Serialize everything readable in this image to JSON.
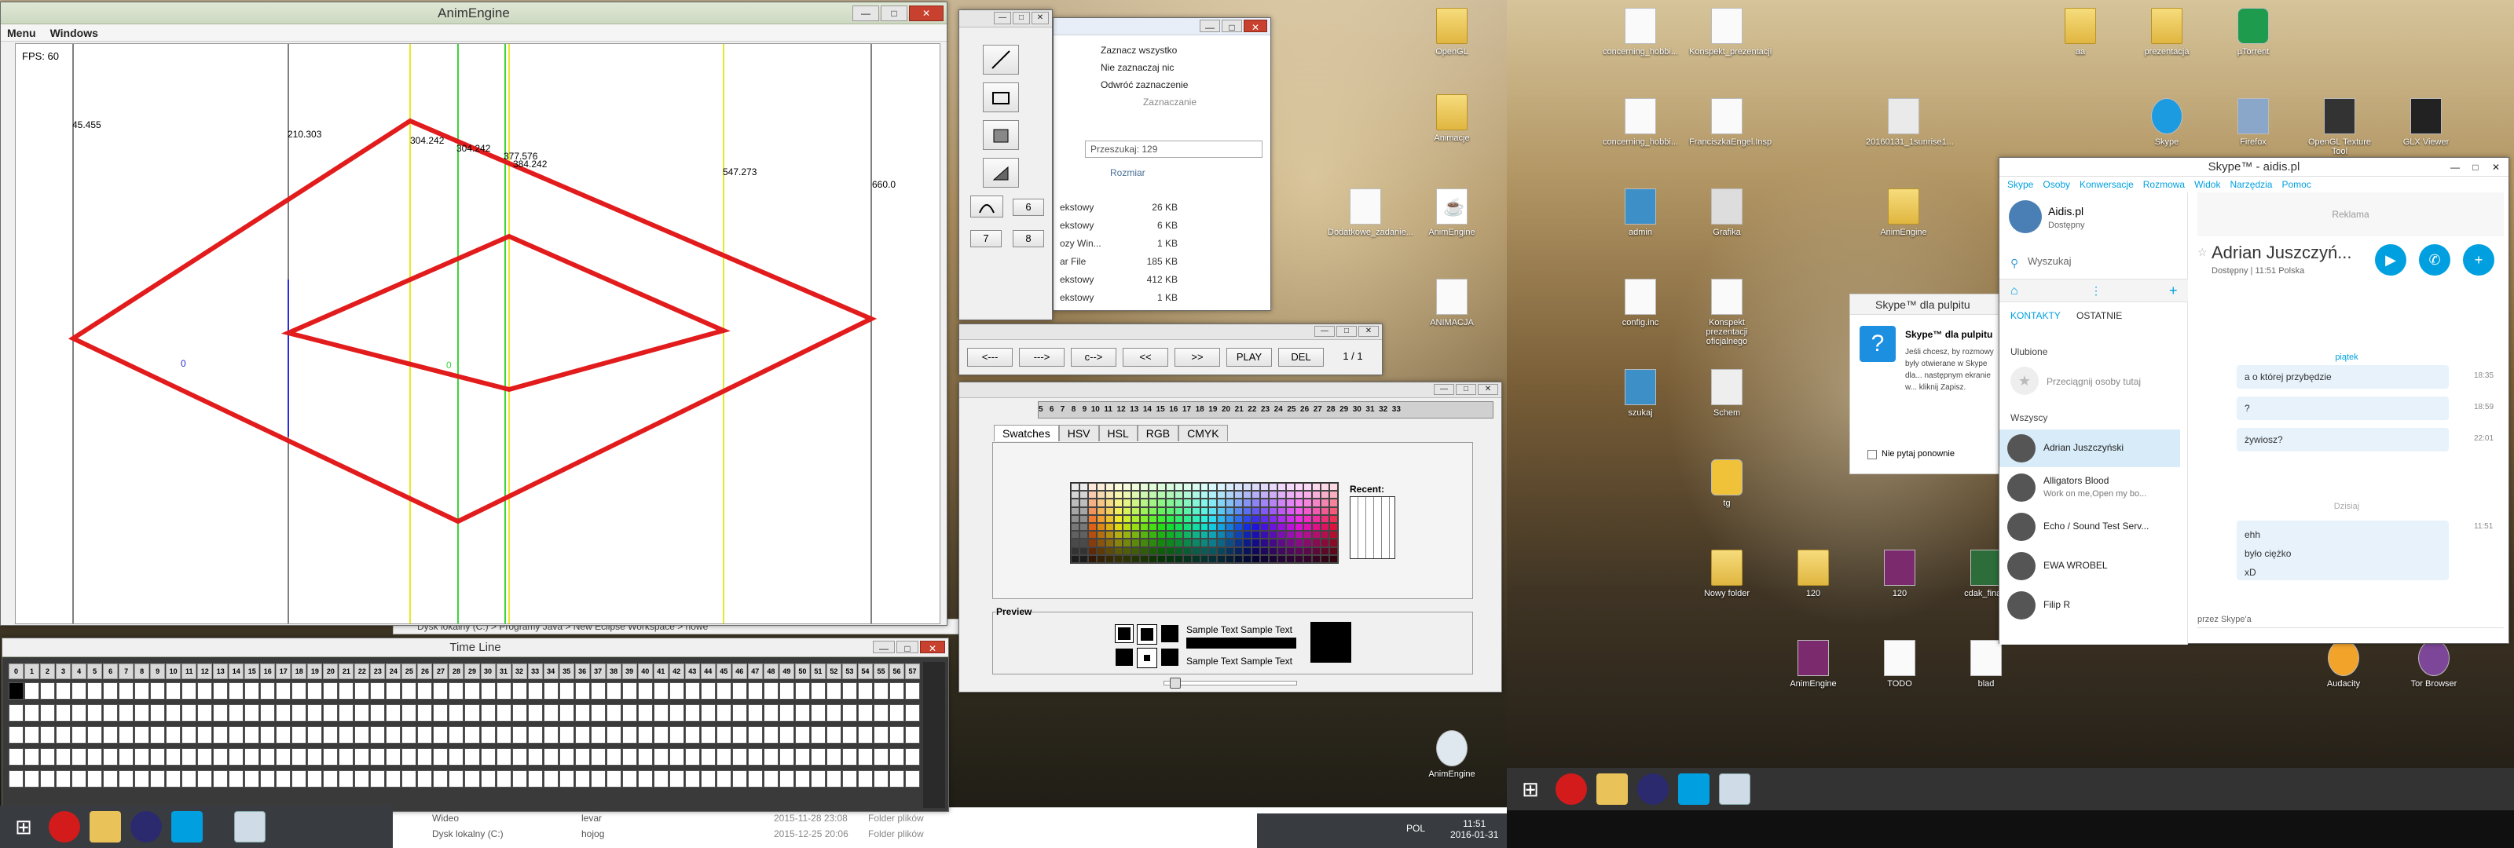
{
  "anim": {
    "title": "AnimEngine",
    "menu": [
      "Menu",
      "Windows"
    ],
    "fps": "FPS: 60",
    "labels": [
      "45.455",
      "210.303",
      "304.242",
      "304.242",
      "377.576",
      "384.242",
      "547.273",
      "660.0",
      "0",
      "0"
    ]
  },
  "timeline": {
    "title": "Time Line",
    "frames": [
      "0",
      "1",
      "2",
      "3",
      "4",
      "5",
      "6",
      "7",
      "8",
      "9",
      "10",
      "11",
      "12",
      "13",
      "14",
      "15",
      "16",
      "17",
      "18",
      "19",
      "20",
      "21",
      "22",
      "23",
      "24",
      "25",
      "26",
      "27",
      "28",
      "29",
      "30",
      "31",
      "32",
      "33",
      "34",
      "35",
      "36",
      "37",
      "38",
      "39",
      "40",
      "41",
      "42",
      "43",
      "44",
      "45",
      "46",
      "47",
      "48",
      "49",
      "50",
      "51",
      "52",
      "53",
      "54",
      "55",
      "56",
      "57"
    ]
  },
  "tools": {
    "buttons": [
      "6",
      "7",
      "8"
    ]
  },
  "controls": {
    "buttons": [
      "<---",
      "--->",
      "c-->",
      "<<",
      ">>",
      "PLAY",
      "DEL"
    ],
    "page": "1 / 1"
  },
  "colorchooser": {
    "ruler": "5   6   7   8   9  10  11  12  13  14  15  16  17  18  19  20  21  22  23  24  25  26  27  28  29  30  31  32  33",
    "tabs": [
      "Swatches",
      "HSV",
      "HSL",
      "RGB",
      "CMYK"
    ],
    "recent": "Recent:",
    "preview": "Preview",
    "sample": "Sample Text  Sample Text",
    "sample2": "Sample Text  Sample Text"
  },
  "explorer": {
    "ribbon": [
      "Zaznacz wszystko",
      "Nie zaznaczaj nic",
      "Odwróć zaznaczenie",
      "Zaznaczanie"
    ],
    "search": "Przeszukaj: 129",
    "col": "Rozmiar",
    "rows": [
      [
        "ekstowy",
        "26 KB"
      ],
      [
        "ekstowy",
        "6 KB"
      ],
      [
        "ozy Win...",
        "1 KB"
      ],
      [
        "ar File",
        "185 KB"
      ],
      [
        "ekstowy",
        "412 KB"
      ],
      [
        "ekstowy",
        "1 KB"
      ]
    ]
  },
  "explorer_bottom": {
    "path": "Dysk lokalny (C:)  >  Programy Java  >  New Eclipse Workspace  >  nowe",
    "rows": [
      [
        "Wideo",
        "2015-11-28 23:08",
        "Folder plików"
      ],
      [
        "Dysk lokalny (C:)",
        "2015-12-25 20:06",
        "Folder plików"
      ]
    ],
    "right": [
      "levar",
      "hojog"
    ]
  },
  "desktop1": {
    "icons": [
      "OpenGL",
      "Animacje",
      "Dodatkowe_zadanie...",
      "AnimEngine",
      "ANIMACJA",
      "AnimEngine"
    ]
  },
  "desktop2": {
    "icons": [
      "concerning_hobbi...",
      "Konspekt_prezentacji",
      "aa",
      "prezentacja",
      "µTorrent",
      "concerning_hobbi...",
      "FranciszkaEngel.Insp",
      "20160131_1sunrise1...",
      "Skype",
      "Firefox",
      "OpenGL Texture Tool",
      "GLX Viewer",
      "admin",
      "Grafika",
      "AnimEngine",
      "config.inc",
      "Konspekt prezentacji oficjalnego",
      "szukaj",
      "Schem",
      "tg",
      "Nowy folder",
      "120",
      "120",
      "cdak_final_",
      "AnimEngine",
      "TODO",
      "blad",
      "Audacity",
      "Tor Browser"
    ]
  },
  "skype": {
    "title": "Skype™ - aidis.pl",
    "menu": [
      "Skype",
      "Osoby",
      "Konwersacje",
      "Rozmowa",
      "Widok",
      "Narzędzia",
      "Pomoc"
    ],
    "user": "Aidis.pl",
    "status": "Dostępny",
    "search": "Wyszukaj",
    "tabs": [
      "KONTAKTY",
      "OSTATNIE"
    ],
    "fav": "Ulubione",
    "drag": "Przeciągnij osoby tutaj",
    "all": "Wszyscy",
    "contacts": [
      {
        "name": "Adrian Juszczyński",
        "sub": ""
      },
      {
        "name": "Alligators Blood",
        "sub": "Work on me,Open my bo..."
      },
      {
        "name": "Echo / Sound Test Serv...",
        "sub": ""
      },
      {
        "name": "EWA WROBEL",
        "sub": ""
      },
      {
        "name": "Filip R",
        "sub": ""
      }
    ],
    "ad": "Reklama",
    "chat_name": "Adrian Juszczyń...",
    "chat_status": "Dostępny  |  11:51 Polska",
    "day1": "piątek",
    "msgs": [
      {
        "text": "a o której przybędzie",
        "time": "18:35"
      },
      {
        "text": "?",
        "time": "18:59"
      },
      {
        "text": "żywiosz?",
        "time": "22:01"
      }
    ],
    "day2": "Dzisiaj",
    "msg_last": [
      "ehh",
      "było ciężko",
      "xD"
    ],
    "msg_last_time": "11:51",
    "via": "przez Skype'a",
    "popup_title": "Skype™ dla pulpitu",
    "popup_head": "Skype™ dla pulpitu",
    "popup_body": "Jeśli chcesz, by rozmowy były otwierane w Skype dla... następnym ekranie w... kliknij Zapisz.",
    "popup_check": "Nie pytaj ponownie"
  },
  "taskbar1": {
    "lang": "POL",
    "time": "11:51",
    "date": "2016-01-31"
  }
}
